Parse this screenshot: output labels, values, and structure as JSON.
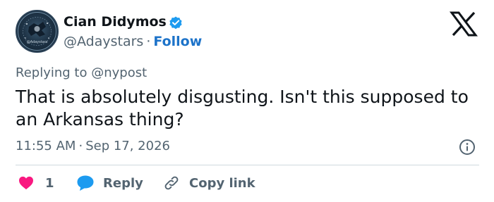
{
  "author": {
    "display_name": "Cian Didymos",
    "handle": "@Adaystars",
    "separator": "·",
    "follow_label": "Follow",
    "verified": true,
    "avatar_caption": "@Adaystars"
  },
  "reply_to": {
    "prefix": "Replying to",
    "target": "@nypost"
  },
  "tweet": {
    "text": "That is absolutely disgusting. Isn't this supposed to an Arkansas thing?",
    "time": "11:55 AM",
    "separator": "·",
    "date": "Sep 17, 2026"
  },
  "actions": {
    "like_count": "1",
    "reply_label": "Reply",
    "copy_link_label": "Copy link"
  },
  "colors": {
    "like_heart": "#f91880",
    "reply_bubble": "#1d9bf0",
    "verified_badge": "#1d9bf0",
    "follow_link": "#1d73c9",
    "muted_text": "#536471"
  },
  "icons": [
    "verified-badge-icon",
    "x-logo-icon",
    "info-icon",
    "heart-icon",
    "speech-bubble-icon",
    "link-icon"
  ]
}
